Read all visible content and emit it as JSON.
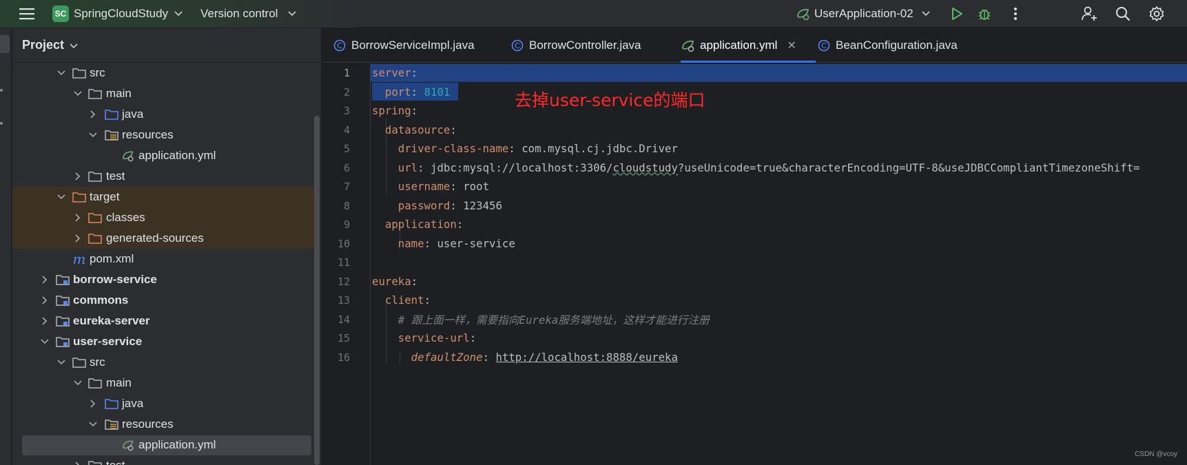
{
  "titlebar": {
    "project_badge": "SC",
    "project_name": "SpringCloudStudy",
    "version_control": "Version control",
    "run_config": "UserApplication-02"
  },
  "project_panel": {
    "title": "Project",
    "rows": [
      {
        "label": "src",
        "icon": "folder-icon"
      },
      {
        "label": "main",
        "icon": "folder-icon"
      },
      {
        "label": "java",
        "icon": "source-folder-icon"
      },
      {
        "label": "resources",
        "icon": "resources-folder-icon"
      },
      {
        "label": "application.yml",
        "icon": "spring-yml-icon"
      },
      {
        "label": "test",
        "icon": "folder-icon"
      },
      {
        "label": "target",
        "icon": "excluded-folder-icon"
      },
      {
        "label": "classes",
        "icon": "excluded-folder-icon"
      },
      {
        "label": "generated-sources",
        "icon": "excluded-folder-icon"
      },
      {
        "label": "pom.xml",
        "icon": "maven-icon"
      },
      {
        "label": "borrow-service",
        "icon": "module-icon"
      },
      {
        "label": "commons",
        "icon": "module-icon"
      },
      {
        "label": "eureka-server",
        "icon": "module-icon"
      },
      {
        "label": "user-service",
        "icon": "module-icon"
      },
      {
        "label": "src",
        "icon": "folder-icon"
      },
      {
        "label": "main",
        "icon": "folder-icon"
      },
      {
        "label": "java",
        "icon": "source-folder-icon"
      },
      {
        "label": "resources",
        "icon": "resources-folder-icon"
      },
      {
        "label": "application.yml",
        "icon": "spring-yml-icon"
      },
      {
        "label": "test",
        "icon": "folder-icon"
      }
    ]
  },
  "tabs": [
    {
      "label": "BorrowServiceImpl.java",
      "icon": "class-icon"
    },
    {
      "label": "BorrowController.java",
      "icon": "class-icon"
    },
    {
      "label": "application.yml",
      "icon": "spring-yml-icon",
      "active": true
    },
    {
      "label": "BeanConfiguration.java",
      "icon": "class-icon"
    }
  ],
  "editor": {
    "line_numbers": [
      "1",
      "2",
      "3",
      "4",
      "5",
      "6",
      "7",
      "8",
      "9",
      "10",
      "11",
      "12",
      "13",
      "14",
      "15",
      "16"
    ],
    "lines": {
      "l1_key": "server",
      "l2_key": "port",
      "l2_val": "8101",
      "l3_key": "spring",
      "l4_key": "datasource",
      "l5_key": "driver-class-name",
      "l5_val": "com.mysql.cj.jdbc.Driver",
      "l6_key": "url",
      "l6_val_a": "jdbc:mysql://localhost:3306/",
      "l6_val_b": "cloudstudy",
      "l6_val_c": "?useUnicode=true&characterEncoding=UTF-8&useJDBCCompliantTimezoneShift=",
      "l7_key": "username",
      "l7_val": "root",
      "l8_key": "password",
      "l8_val": "123456",
      "l9_key": "application",
      "l10_key": "name",
      "l10_val": "user-service",
      "l12_key": "eureka",
      "l13_key": "client",
      "l14_comment": "# 跟上面一样，需要指向Eureka服务端地址，这样才能进行注册",
      "l15_key": "service-url",
      "l16_key": "defaultZone",
      "l16_val": "http://localhost:8888/eureka"
    },
    "annotation": "去掉user-service的端口"
  },
  "watermark": "CSDN @vcoy",
  "colors": {
    "accent": "#3574f0",
    "keyword": "#cf8e6d",
    "number": "#2aacb8",
    "annotation": "#ff2a2a",
    "selection": "#214283"
  }
}
